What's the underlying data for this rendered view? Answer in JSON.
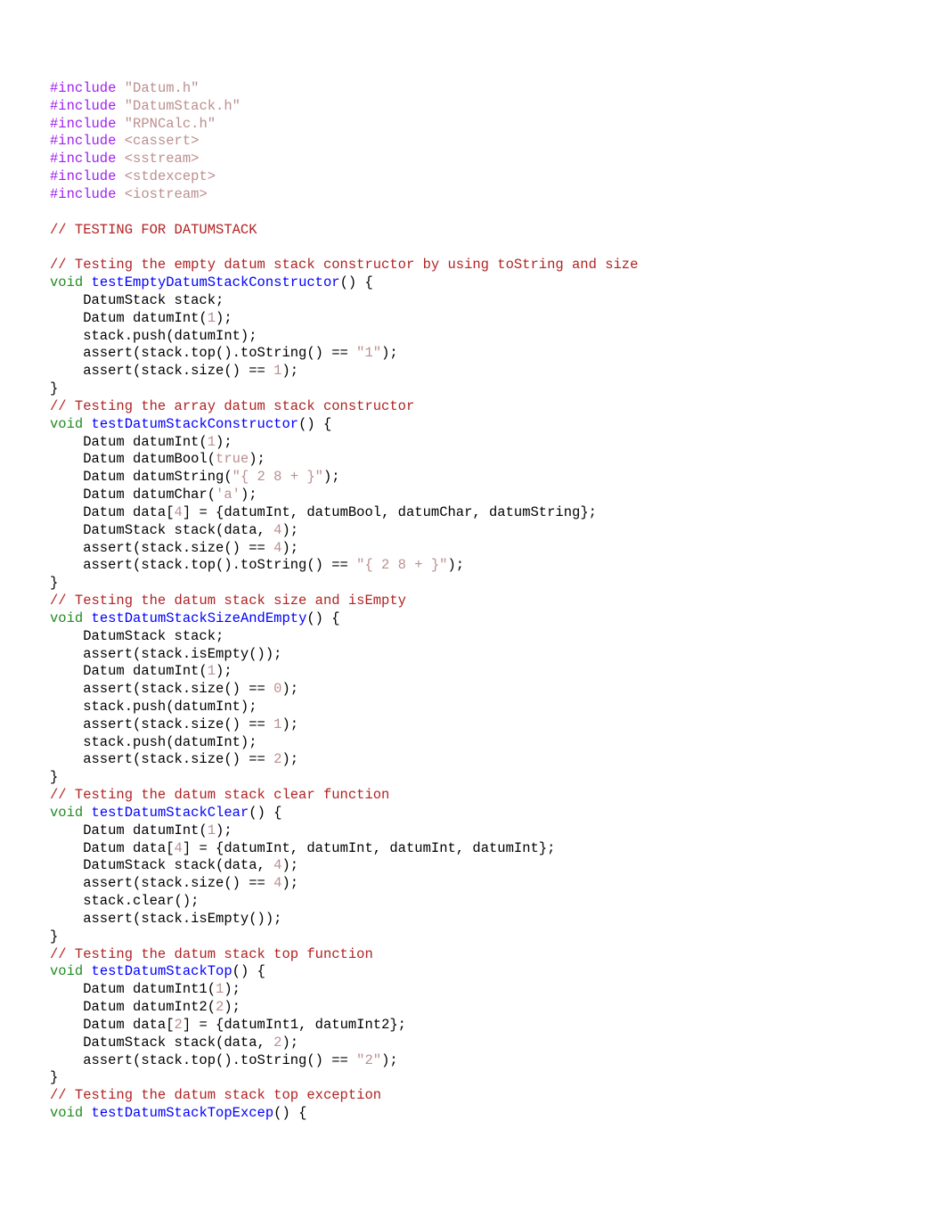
{
  "includes": [
    {
      "directive": "#include",
      "header": "\"Datum.h\""
    },
    {
      "directive": "#include",
      "header": "\"DatumStack.h\""
    },
    {
      "directive": "#include",
      "header": "\"RPNCalc.h\""
    },
    {
      "directive": "#include",
      "header": "<cassert>"
    },
    {
      "directive": "#include",
      "header": "<sstream>"
    },
    {
      "directive": "#include",
      "header": "<stdexcept>"
    },
    {
      "directive": "#include",
      "header": "<iostream>"
    }
  ],
  "section_comment": "// TESTING FOR DATUMSTACK",
  "functions": [
    {
      "comment": "// Testing the empty datum stack constructor by using toString and size",
      "ret": "void",
      "name": "testEmptyDatumStackConstructor",
      "body_lines": [
        {
          "indent": "    ",
          "segments": [
            {
              "text": "DatumStack stack;"
            }
          ]
        },
        {
          "indent": "    ",
          "segments": [
            {
              "text": "Datum datumInt("
            },
            {
              "cls": "num",
              "text": "1"
            },
            {
              "text": ");"
            }
          ]
        },
        {
          "indent": "    ",
          "segments": [
            {
              "text": "stack.push(datumInt);"
            }
          ]
        },
        {
          "indent": "    ",
          "segments": [
            {
              "text": "assert(stack.top().toString() == "
            },
            {
              "cls": "str",
              "text": "\"1\""
            },
            {
              "text": ");"
            }
          ]
        },
        {
          "indent": "    ",
          "segments": [
            {
              "text": "assert(stack.size() == "
            },
            {
              "cls": "num",
              "text": "1"
            },
            {
              "text": ");"
            }
          ]
        }
      ]
    },
    {
      "comment": "// Testing the array datum stack constructor",
      "ret": "void",
      "name": "testDatumStackConstructor",
      "body_lines": [
        {
          "indent": "    ",
          "segments": [
            {
              "text": "Datum datumInt("
            },
            {
              "cls": "num",
              "text": "1"
            },
            {
              "text": ");"
            }
          ]
        },
        {
          "indent": "    ",
          "segments": [
            {
              "text": "Datum datumBool("
            },
            {
              "cls": "bool",
              "text": "true"
            },
            {
              "text": ");"
            }
          ]
        },
        {
          "indent": "    ",
          "segments": [
            {
              "text": "Datum datumString("
            },
            {
              "cls": "str",
              "text": "\"{ 2 8 + }\""
            },
            {
              "text": ");"
            }
          ]
        },
        {
          "indent": "    ",
          "segments": [
            {
              "text": "Datum datumChar("
            },
            {
              "cls": "str",
              "text": "'a'"
            },
            {
              "text": ");"
            }
          ]
        },
        {
          "indent": "    ",
          "segments": [
            {
              "text": "Datum data["
            },
            {
              "cls": "num",
              "text": "4"
            },
            {
              "text": "] = {datumInt, datumBool, datumChar, datumString};"
            }
          ]
        },
        {
          "indent": "    ",
          "segments": [
            {
              "text": "DatumStack stack(data, "
            },
            {
              "cls": "num",
              "text": "4"
            },
            {
              "text": ");"
            }
          ]
        },
        {
          "indent": "    ",
          "segments": [
            {
              "text": "assert(stack.size() == "
            },
            {
              "cls": "num",
              "text": "4"
            },
            {
              "text": ");"
            }
          ]
        },
        {
          "indent": "    ",
          "segments": [
            {
              "text": "assert(stack.top().toString() == "
            },
            {
              "cls": "str",
              "text": "\"{ 2 8 + }\""
            },
            {
              "text": ");"
            }
          ]
        }
      ]
    },
    {
      "comment": "// Testing the datum stack size and isEmpty",
      "ret": "void",
      "name": "testDatumStackSizeAndEmpty",
      "body_lines": [
        {
          "indent": "    ",
          "segments": [
            {
              "text": "DatumStack stack;"
            }
          ]
        },
        {
          "indent": "    ",
          "segments": [
            {
              "text": "assert(stack.isEmpty());"
            }
          ]
        },
        {
          "indent": "    ",
          "segments": [
            {
              "text": "Datum datumInt("
            },
            {
              "cls": "num",
              "text": "1"
            },
            {
              "text": ");"
            }
          ]
        },
        {
          "indent": "    ",
          "segments": [
            {
              "text": "assert(stack.size() == "
            },
            {
              "cls": "num",
              "text": "0"
            },
            {
              "text": ");"
            }
          ]
        },
        {
          "indent": "    ",
          "segments": [
            {
              "text": "stack.push(datumInt);"
            }
          ]
        },
        {
          "indent": "    ",
          "segments": [
            {
              "text": "assert(stack.size() == "
            },
            {
              "cls": "num",
              "text": "1"
            },
            {
              "text": ");"
            }
          ]
        },
        {
          "indent": "    ",
          "segments": [
            {
              "text": "stack.push(datumInt);"
            }
          ]
        },
        {
          "indent": "    ",
          "segments": [
            {
              "text": "assert(stack.size() == "
            },
            {
              "cls": "num",
              "text": "2"
            },
            {
              "text": ");"
            }
          ]
        }
      ]
    },
    {
      "comment": "// Testing the datum stack clear function",
      "ret": "void",
      "name": "testDatumStackClear",
      "body_lines": [
        {
          "indent": "    ",
          "segments": [
            {
              "text": "Datum datumInt("
            },
            {
              "cls": "num",
              "text": "1"
            },
            {
              "text": ");"
            }
          ]
        },
        {
          "indent": "    ",
          "segments": [
            {
              "text": "Datum data["
            },
            {
              "cls": "num",
              "text": "4"
            },
            {
              "text": "] = {datumInt, datumInt, datumInt, datumInt};"
            }
          ]
        },
        {
          "indent": "    ",
          "segments": [
            {
              "text": "DatumStack stack(data, "
            },
            {
              "cls": "num",
              "text": "4"
            },
            {
              "text": ");"
            }
          ]
        },
        {
          "indent": "    ",
          "segments": [
            {
              "text": "assert(stack.size() == "
            },
            {
              "cls": "num",
              "text": "4"
            },
            {
              "text": ");"
            }
          ]
        },
        {
          "indent": "    ",
          "segments": [
            {
              "text": "stack.clear();"
            }
          ]
        },
        {
          "indent": "    ",
          "segments": [
            {
              "text": "assert(stack.isEmpty());"
            }
          ]
        }
      ]
    },
    {
      "comment": "// Testing the datum stack top function",
      "ret": "void",
      "name": "testDatumStackTop",
      "body_lines": [
        {
          "indent": "    ",
          "segments": [
            {
              "text": "Datum datumInt1("
            },
            {
              "cls": "num",
              "text": "1"
            },
            {
              "text": ");"
            }
          ]
        },
        {
          "indent": "    ",
          "segments": [
            {
              "text": "Datum datumInt2("
            },
            {
              "cls": "num",
              "text": "2"
            },
            {
              "text": ");"
            }
          ]
        },
        {
          "indent": "    ",
          "segments": [
            {
              "text": "Datum data["
            },
            {
              "cls": "num",
              "text": "2"
            },
            {
              "text": "] = {datumInt1, datumInt2};"
            }
          ]
        },
        {
          "indent": "    ",
          "segments": [
            {
              "text": "DatumStack stack(data, "
            },
            {
              "cls": "num",
              "text": "2"
            },
            {
              "text": ");"
            }
          ]
        },
        {
          "indent": "    ",
          "segments": [
            {
              "text": "assert(stack.top().toString() == "
            },
            {
              "cls": "str",
              "text": "\"2\""
            },
            {
              "text": ");"
            }
          ]
        }
      ]
    },
    {
      "comment": "// Testing the datum stack top exception",
      "ret": "void",
      "name": "testDatumStackTopExcep",
      "body_lines": []
    }
  ]
}
